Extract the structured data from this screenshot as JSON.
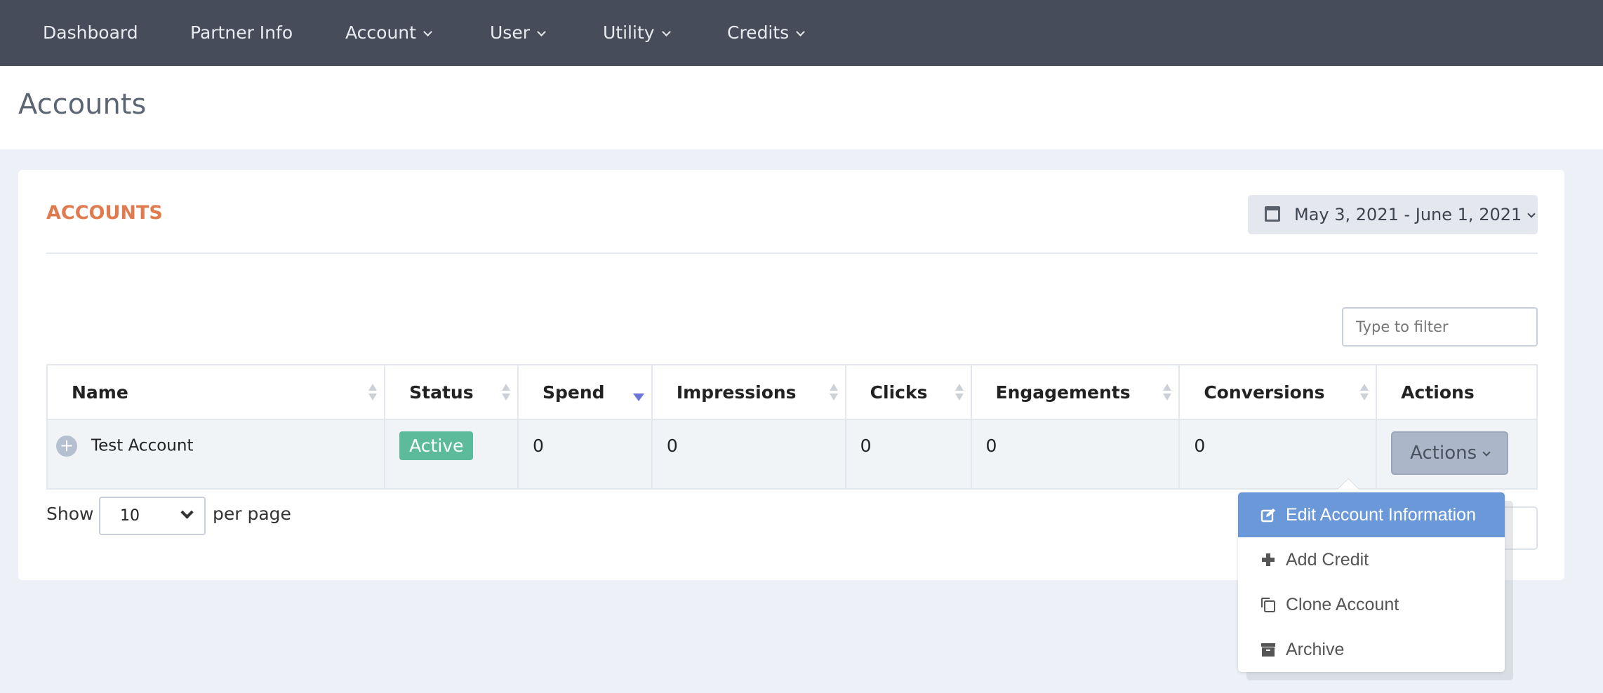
{
  "nav": {
    "items": [
      {
        "label": "Dashboard",
        "dropdown": false
      },
      {
        "label": "Partner Info",
        "dropdown": false
      },
      {
        "label": "Account",
        "dropdown": true
      },
      {
        "label": "User",
        "dropdown": true
      },
      {
        "label": "Utility",
        "dropdown": true
      },
      {
        "label": "Credits",
        "dropdown": true
      }
    ]
  },
  "page": {
    "title": "Accounts"
  },
  "card": {
    "title": "ACCOUNTS",
    "date_range": "May 3, 2021 - June 1, 2021",
    "filter_placeholder": "Type to filter"
  },
  "table": {
    "columns": [
      "Name",
      "Status",
      "Spend",
      "Impressions",
      "Clicks",
      "Engagements",
      "Conversions",
      "Actions"
    ],
    "sorted_column": "Spend",
    "sort_direction": "desc",
    "rows": [
      {
        "name": "Test Account",
        "status": "Active",
        "spend": "0",
        "impressions": "0",
        "clicks": "0",
        "engagements": "0",
        "conversions": "0",
        "actions_label": "Actions"
      }
    ]
  },
  "pagination": {
    "show_label": "Show",
    "page_size": "10",
    "per_page_label": "per page"
  },
  "actions_menu": {
    "items": [
      {
        "label": "Edit Account Information",
        "icon": "edit-icon",
        "highlighted": true
      },
      {
        "label": "Add Credit",
        "icon": "plus-icon"
      },
      {
        "label": "Clone Account",
        "icon": "clone-icon"
      },
      {
        "label": "Archive",
        "icon": "archive-icon"
      }
    ]
  },
  "colors": {
    "nav_bg": "#464c59",
    "accent": "#e07b4f",
    "active_badge": "#5bbb9a",
    "menu_highlight": "#6a98d8"
  }
}
